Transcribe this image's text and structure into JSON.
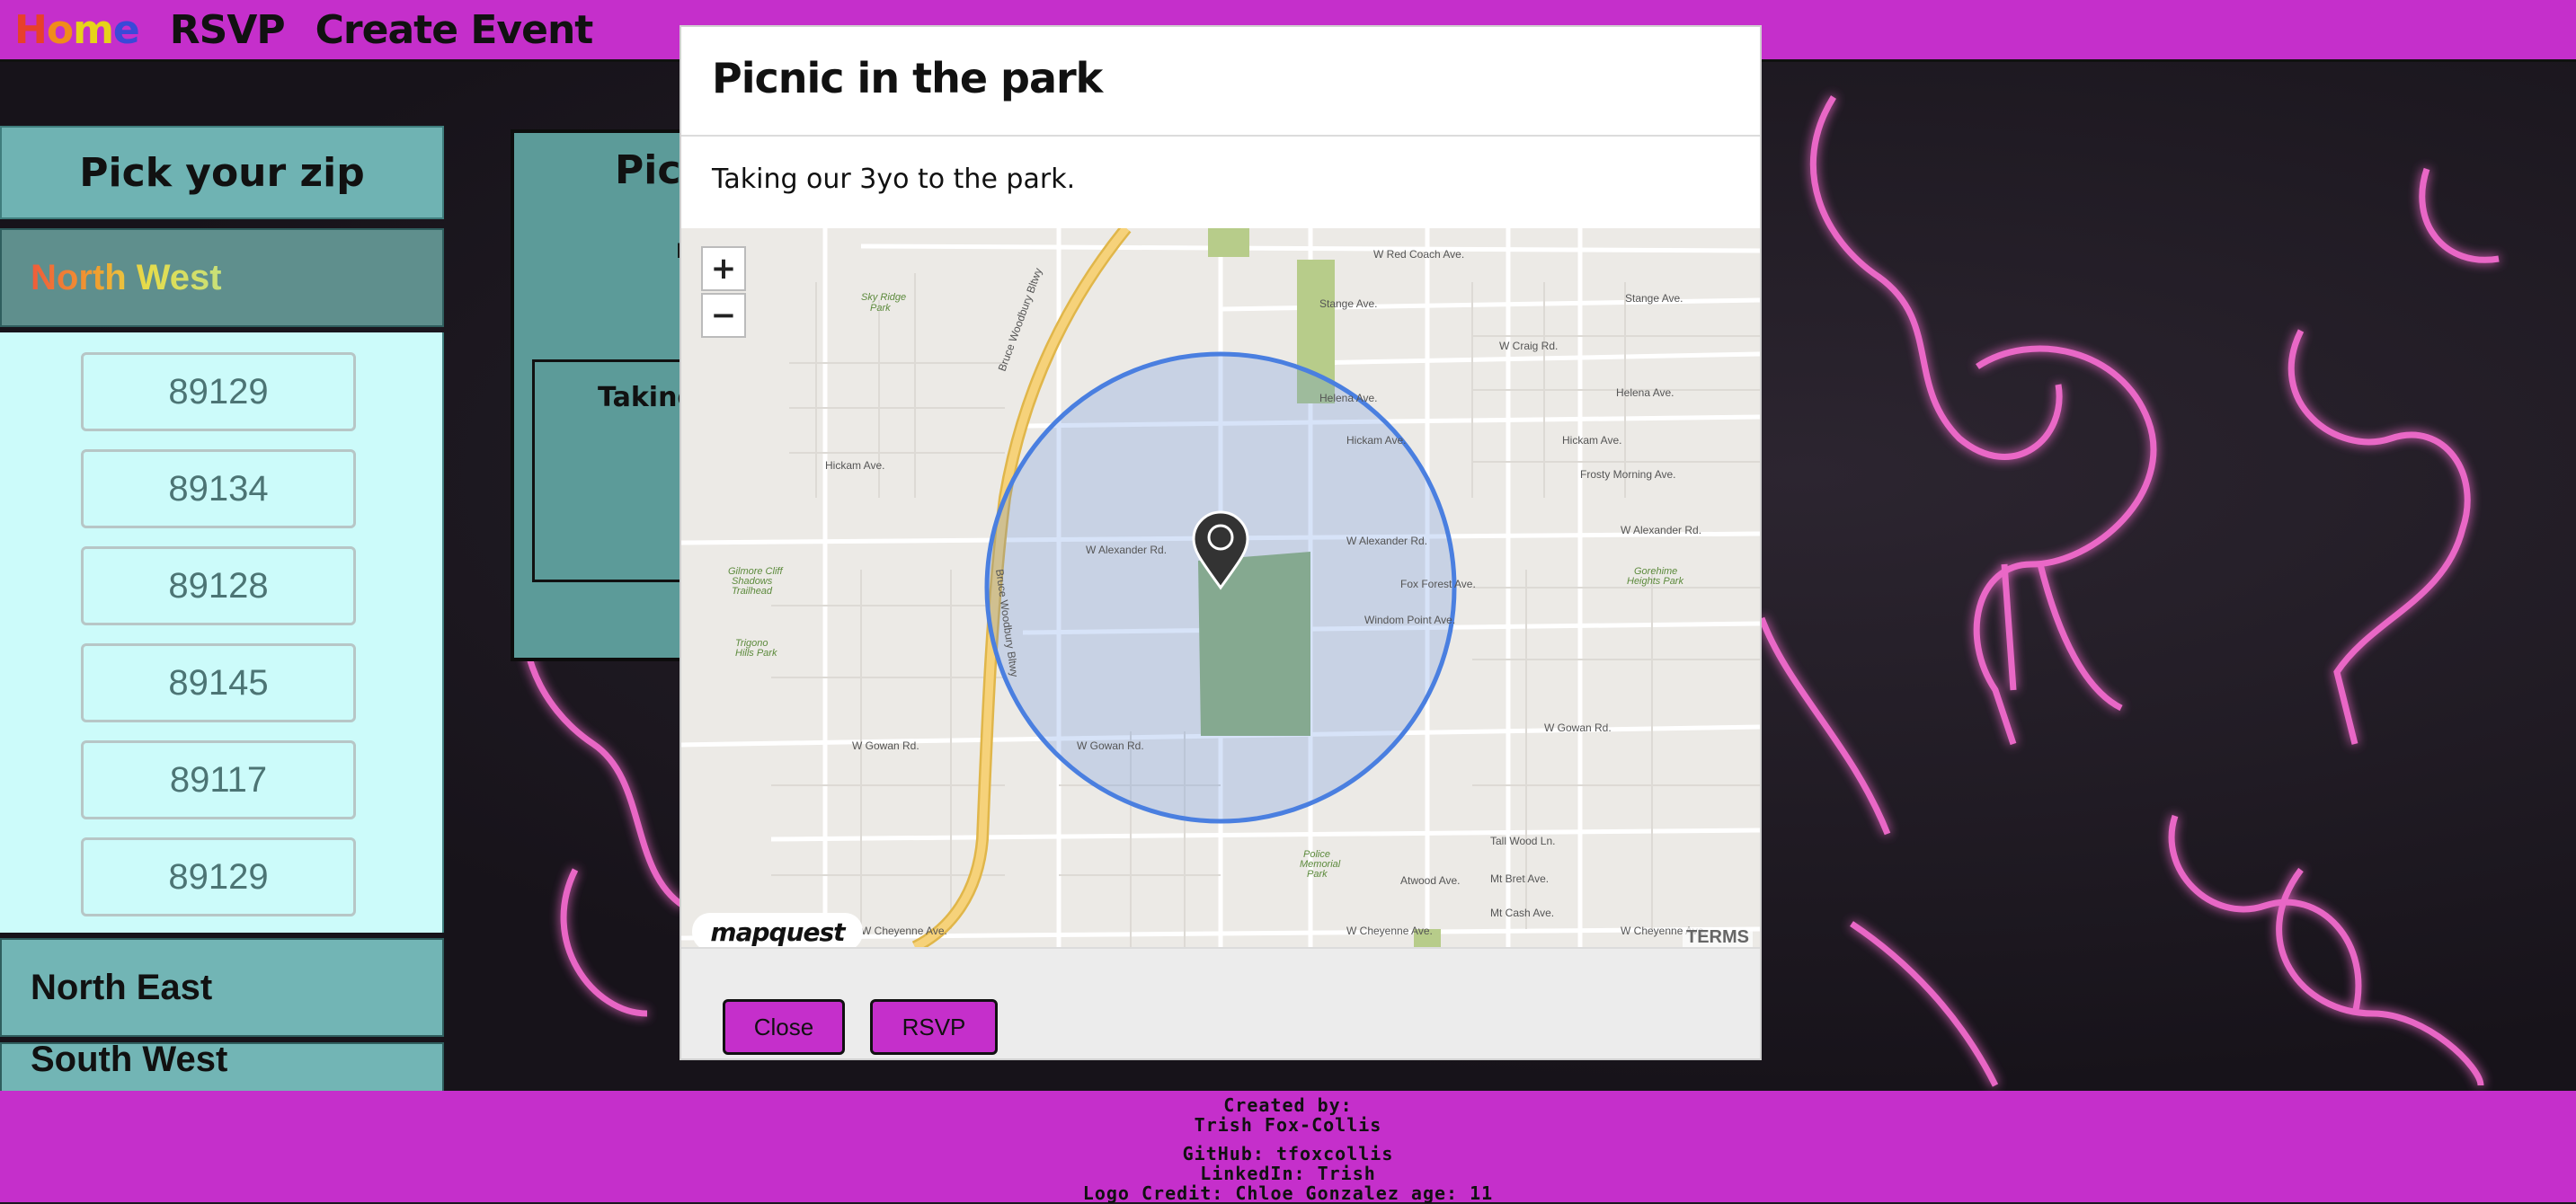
{
  "nav": {
    "home_label": [
      "H",
      "o",
      "m",
      "e"
    ],
    "rsvp_label": "RSVP",
    "create_label": "Create Event"
  },
  "sidebar": {
    "heading": "Pick your zip",
    "regions": [
      {
        "label": "North West"
      },
      {
        "label": "North East"
      },
      {
        "label": "South West"
      }
    ],
    "zips": [
      "89129",
      "89134",
      "89128",
      "89145",
      "89117",
      "89129"
    ]
  },
  "event_card": {
    "title_fragment": "Pic",
    "date_fragment": "D",
    "desc_fragment": "Taking"
  },
  "modal": {
    "title": "Picnic in the park",
    "description": "Taking our 3yo to the park.",
    "close_label": "Close",
    "rsvp_label": "RSVP",
    "zoom_in": "+",
    "zoom_out": "−",
    "map_logo": "mapquest",
    "terms": "TERMS",
    "map_labels": {
      "streets": [
        "W Red Coach Ave.",
        "Stange Ave.",
        "W Craig Rd.",
        "Helena Ave.",
        "Hickam Ave.",
        "Frosty Morning Ave.",
        "W Alexander Rd.",
        "Fox Forest Ave.",
        "Windom Point Ave.",
        "W Gowan Rd.",
        "Tall Wood Ln.",
        "Atwood Ave.",
        "Mt Bret Ave.",
        "Mt Cash Ave.",
        "W Cheyenne Ave.",
        "Bruce Woodbury Bltwy",
        "Stange Ave.",
        "Hickam Ave.",
        "Helena Ave."
      ],
      "parks": [
        "Sky Ridge Park",
        "Gilmore Cliff Shadows Trailhead",
        "Trigono Hills Park",
        "Police Memorial Park",
        "Gorehime Heights Park"
      ]
    }
  },
  "footer": {
    "created_by": "Created by:",
    "author": "Trish Fox-Collis",
    "github": "GitHub: tfoxcollis",
    "linkedin": "LinkedIn: Trish",
    "logo_credit": "Logo Credit: Chloe Gonzalez age: 11"
  },
  "colors": {
    "accent": "#c52fcb",
    "teal": "#6fb3b3",
    "zip_panel": "#ccfbfa",
    "map_circle": "#4a7fe0"
  }
}
